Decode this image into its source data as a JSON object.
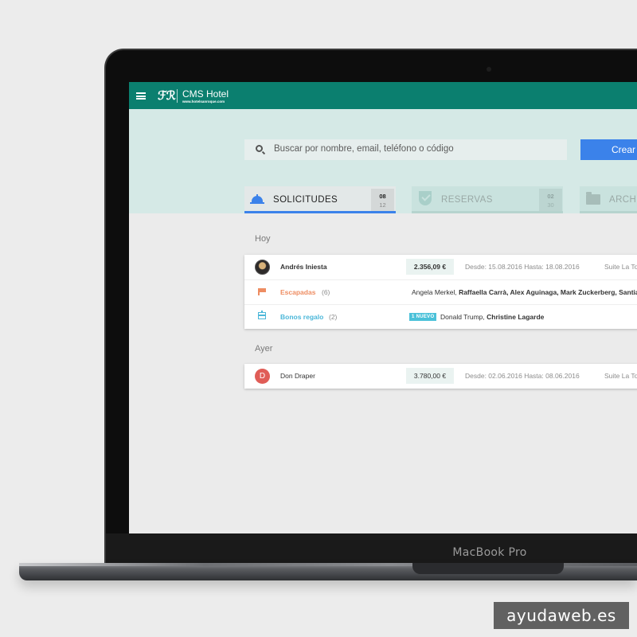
{
  "device": {
    "brand": "MacBook Pro"
  },
  "topbar": {
    "logo_mark": "ℱℛ",
    "title": "CMS Hotel",
    "subtitle": "www.hotelsanroque.com"
  },
  "search": {
    "placeholder": "Buscar por nombre, email, teléfono o código"
  },
  "create_button": "Crear",
  "tabs": [
    {
      "label": "SOLICITUDES",
      "count_top": "08",
      "count_bottom": "12",
      "icon": "bell-icon",
      "active": true
    },
    {
      "label": "RESERVAS",
      "count_top": "02",
      "count_bottom": "30",
      "icon": "shield-check-icon",
      "active": false
    },
    {
      "label": "ARCHI",
      "icon": "folder-icon",
      "active": false
    }
  ],
  "groups": [
    {
      "label": "Hoy",
      "rows": [
        {
          "name": "Andrés Iniesta",
          "price": "2.356,09 €",
          "dates": "Desde: 15.08.2016 Hasta: 18.08.2016",
          "room": "Suite La To"
        },
        {
          "category": "Escapadas",
          "count": "(6)",
          "people_plain": "Angela Merkel, ",
          "people_bold": "Raffaella Carrà, Alex Aguinaga, Mark Zuckerberg, Santia"
        },
        {
          "category": "Bonos regalo",
          "count": "(2)",
          "badge": "1 NUEVO",
          "people_plain": "Donald Trump, ",
          "people_bold": "Christine Lagarde"
        }
      ]
    },
    {
      "label": "Ayer",
      "rows": [
        {
          "avatar_letter": "D",
          "name": "Don Draper",
          "price": "3.780,00 €",
          "dates": "Desde: 02.06.2016 Hasta: 08.06.2016",
          "room": "Suite La To"
        }
      ]
    }
  ],
  "watermark": "ayudaweb.es",
  "colors": {
    "topbar": "#0b7f6f",
    "hero": "#d5e9e6",
    "accent": "#3b82ea",
    "escapadas": "#ee8d62",
    "bonos": "#4bb7d9",
    "avatar_d": "#e05d57"
  }
}
